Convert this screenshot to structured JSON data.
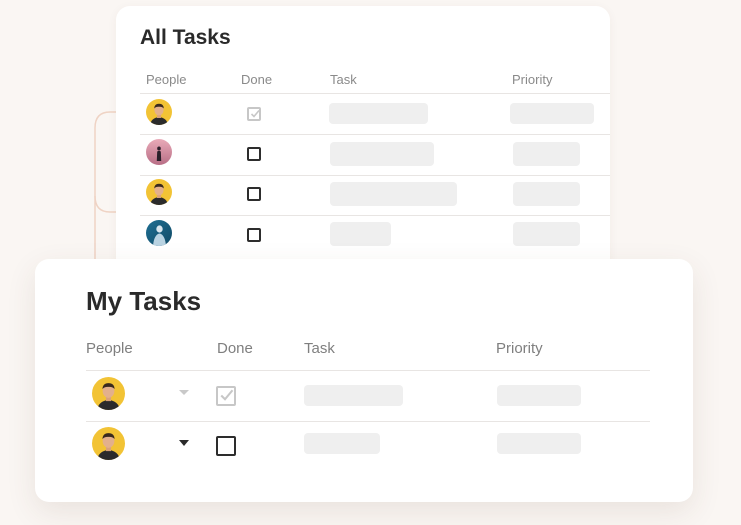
{
  "all_tasks": {
    "title": "All Tasks",
    "headers": {
      "people": "People",
      "done": "Done",
      "task": "Task",
      "priority": "Priority"
    },
    "rows": [
      {
        "avatar": "yellow-man",
        "done": true
      },
      {
        "avatar": "pink-figure",
        "done": false
      },
      {
        "avatar": "yellow-man",
        "done": false
      },
      {
        "avatar": "blue-figure",
        "done": false
      }
    ]
  },
  "my_tasks": {
    "title": "My Tasks",
    "headers": {
      "people": "People",
      "done": "Done",
      "task": "Task",
      "priority": "Priority"
    },
    "rows": [
      {
        "avatar": "yellow-man",
        "done": true,
        "dropdown": "muted"
      },
      {
        "avatar": "yellow-man",
        "done": false,
        "dropdown": "active"
      }
    ]
  },
  "colors": {
    "background": "#faf6f3",
    "card": "#ffffff",
    "connector": "#efd3c4",
    "placeholder": "#efefef",
    "avatar_yellow": "#f2c335"
  }
}
